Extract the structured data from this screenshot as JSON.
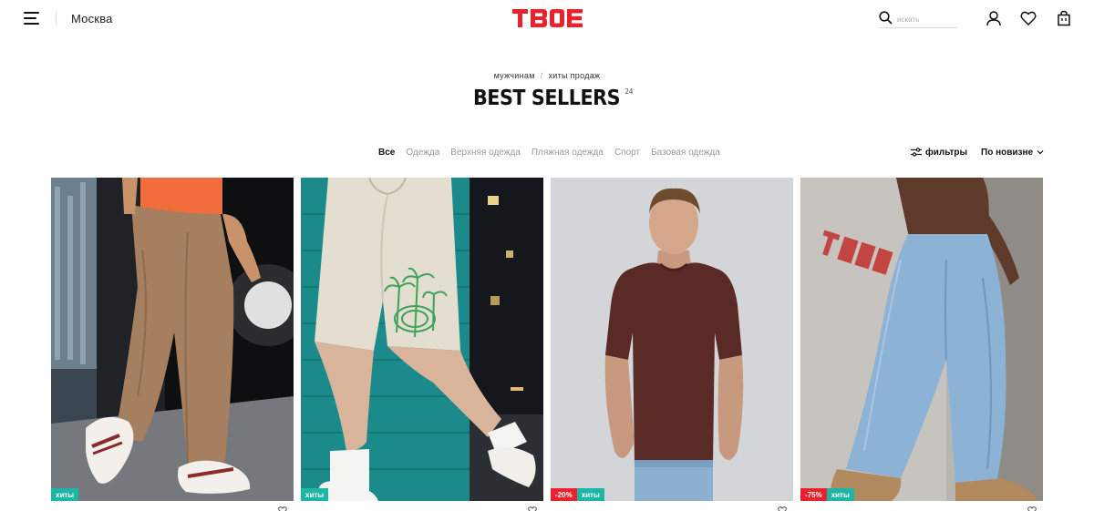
{
  "header": {
    "city": "Москва",
    "logo_text": "ТВОЕ",
    "search_placeholder": "искать",
    "brand_color": "#e8232e"
  },
  "breadcrumb": {
    "items": [
      "мужчинам",
      "хиты продаж"
    ],
    "separator": "/"
  },
  "page": {
    "title": "BEST SELLERS",
    "count": "24"
  },
  "categories": [
    {
      "label": "Все",
      "active": true
    },
    {
      "label": "Одежда",
      "active": false
    },
    {
      "label": "Верхняя одежда",
      "active": false
    },
    {
      "label": "Пляжная одежда",
      "active": false
    },
    {
      "label": "Спорт",
      "active": false
    },
    {
      "label": "Базовая одежда",
      "active": false
    }
  ],
  "toolbar": {
    "filters_label": "фильтры",
    "sort_label": "По новизне"
  },
  "products": [
    {
      "badges": [
        "хиты"
      ],
      "discount": "",
      "price": "",
      "image": "brown wide corduroy trousers with white sneakers"
    },
    {
      "badges": [
        "хиты"
      ],
      "discount": "",
      "price": "",
      "image": "beige sweat shorts with green palm print"
    },
    {
      "badges": [
        "хиты"
      ],
      "discount": "-20%",
      "price": "",
      "image": "dark brown basic t-shirt with light jeans"
    },
    {
      "badges": [
        "хиты"
      ],
      "discount": "-75%",
      "price": "",
      "image": "light blue wide baggy jeans"
    }
  ],
  "colors": {
    "hit_badge": "#1db5a4",
    "sale_badge": "#e8232e"
  }
}
